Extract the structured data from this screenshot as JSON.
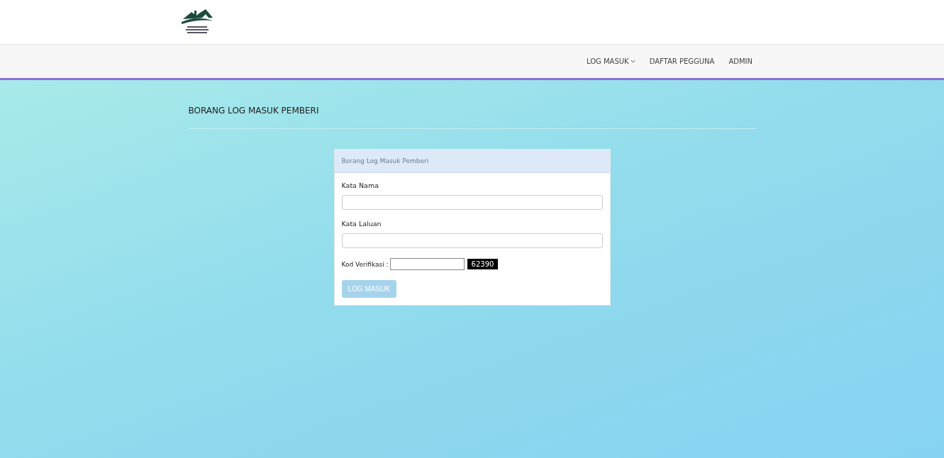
{
  "nav": [
    {
      "label": "LOG MASUK",
      "dropdown": true
    },
    {
      "label": "DAFTAR PEGGUNA",
      "dropdown": false
    },
    {
      "label": "ADMIN",
      "dropdown": false
    }
  ],
  "page_title": "BORANG LOG MASUK PEMBERI",
  "panel": {
    "heading": "Borang Log Masuk Pemberi",
    "fields": [
      {
        "label": "Kata Nama"
      },
      {
        "label": "Kata Laluan"
      }
    ],
    "verification": {
      "label": "Kod Verifikasi :",
      "code": "62390"
    },
    "submit": {
      "label": "LOG MASUK",
      "disabled": true
    }
  }
}
